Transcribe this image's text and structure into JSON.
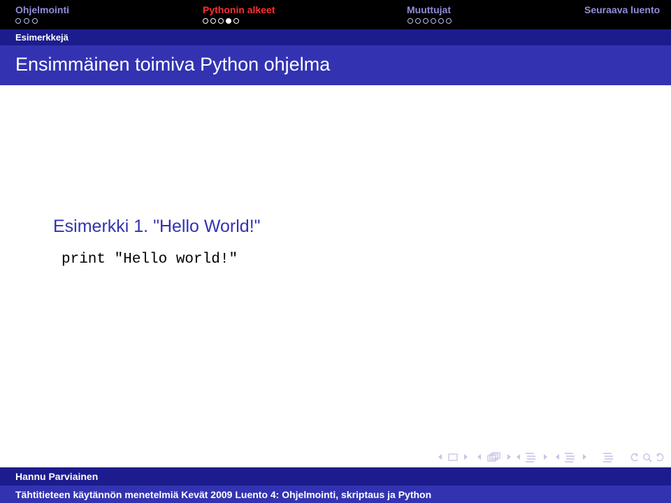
{
  "navigation": {
    "sections": [
      {
        "label": "Ohjelmointi",
        "dots": 3,
        "filled_index": null,
        "active": false
      },
      {
        "label": "Pythonin alkeet",
        "dots": 5,
        "filled_index": 3,
        "active": true
      },
      {
        "label": "Muuttujat",
        "dots": 6,
        "filled_index": null,
        "active": false
      },
      {
        "label": "Seuraava luento",
        "dots": 0,
        "filled_index": null,
        "active": false
      }
    ]
  },
  "subsection": "Esimerkkejä",
  "frame_title": "Ensimmäinen toimiva Python ohjelma",
  "content": {
    "example_title": "Esimerkki 1. \"Hello World!\"",
    "code": "print \"Hello world!\""
  },
  "footer": {
    "author": "Hannu Parviainen",
    "title": "Tähtitieteen käytännön menetelmiä Kevät 2009 Luento 4: Ohjelmointi, skriptaus ja Python"
  },
  "navsymbol_icons": [
    "nav-slide-icon",
    "nav-frame-icon",
    "nav-subsection-icon",
    "nav-section-icon",
    "nav-document-icon",
    "nav-search-icon"
  ],
  "colors": {
    "nav_bg": "#000000",
    "nav_active": "#ff2f2f",
    "nav_inactive": "#8e8edc",
    "band_dark": "#1c1c8e",
    "band_main": "#3333b2"
  }
}
